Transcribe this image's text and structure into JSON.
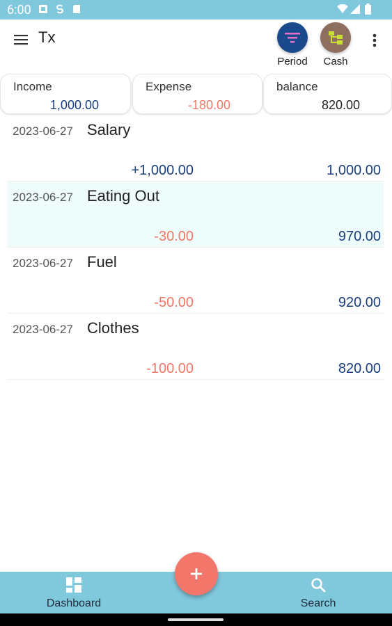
{
  "status_bar": {
    "time": "6:00"
  },
  "app_bar": {
    "title": "Tx",
    "actions": [
      {
        "label": "Period",
        "icon": "filter-icon",
        "color": "#1a4a8c",
        "icon_color": "#e070c8"
      },
      {
        "label": "Cash",
        "icon": "account-tree-icon",
        "color": "#8d6e5f",
        "icon_color": "#c8e035"
      }
    ]
  },
  "summary": {
    "income": {
      "label": "Income",
      "value": "1,000.00"
    },
    "expense": {
      "label": "Expense",
      "value": "-180.00"
    },
    "balance": {
      "label": "balance",
      "value": "820.00"
    }
  },
  "transactions": [
    {
      "date": "2023-06-27",
      "name": "Salary",
      "amount": "+1,000.00",
      "balance": "1,000.00"
    },
    {
      "date": "2023-06-27",
      "name": "Eating Out",
      "amount": "-30.00",
      "balance": "970.00"
    },
    {
      "date": "2023-06-27",
      "name": "Fuel",
      "amount": "-50.00",
      "balance": "920.00"
    },
    {
      "date": "2023-06-27",
      "name": "Clothes",
      "amount": "-100.00",
      "balance": "820.00"
    }
  ],
  "bottom_nav": {
    "dashboard_label": "Dashboard",
    "search_label": "Search"
  },
  "colors": {
    "status_bar": "#80c8dc",
    "positive": "#1a3d7c",
    "negative": "#ef7768",
    "fab": "#f2766a",
    "selected_row": "#eefcfb"
  }
}
